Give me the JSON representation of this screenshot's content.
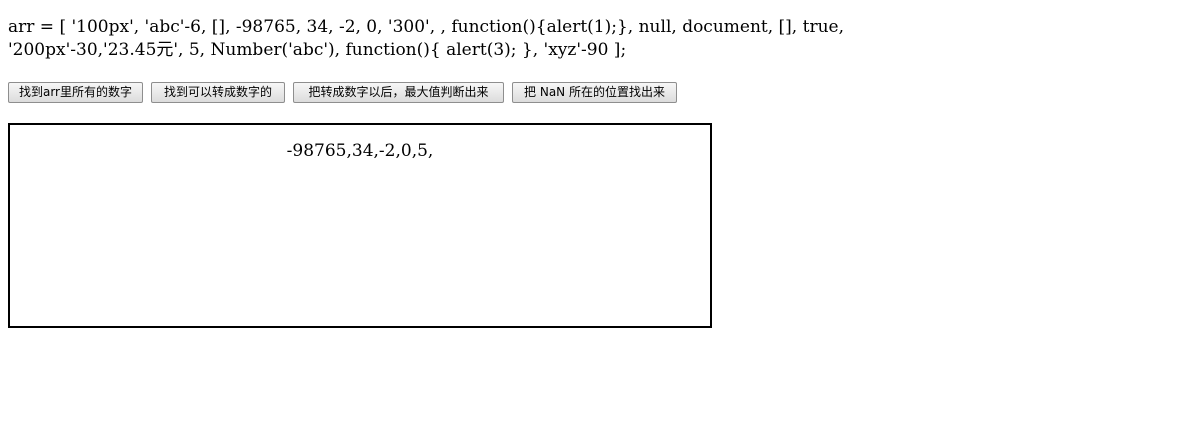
{
  "code": {
    "line1": "arr = [ '100px', 'abc'-6, [], -98765, 34, -2, 0, '300', , function(){alert(1);}, null, document, [], true,",
    "line2": "'200px'-30,'23.45元', 5, Number('abc'), function(){ alert(3); }, 'xyz'-90 ];"
  },
  "buttons": {
    "find_numbers": "找到arr里所有的数字",
    "find_convertible": "找到可以转成数字的",
    "max_after_convert": "把转成数字以后，最大值判断出来",
    "find_nan_positions": "把 NaN 所在的位置找出来"
  },
  "result": {
    "text": "-98765,34,-2,0,5,"
  }
}
